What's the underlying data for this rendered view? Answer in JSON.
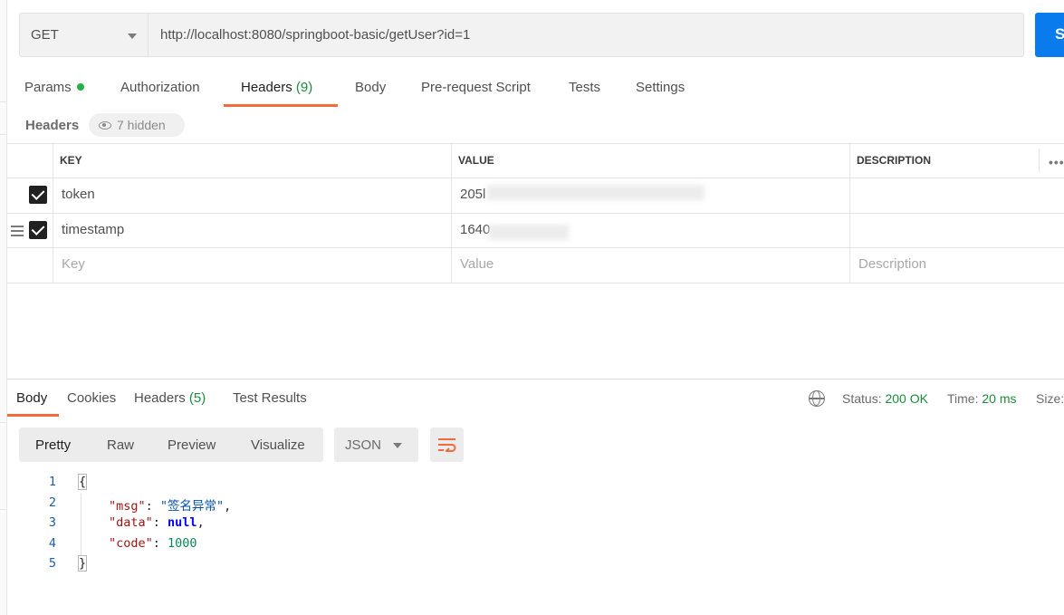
{
  "request": {
    "method": "GET",
    "url": "http://localhost:8080/springboot-basic/getUser?id=1",
    "send_label": "S"
  },
  "request_tabs": {
    "params": "Params",
    "authorization": "Authorization",
    "headers": "Headers",
    "headers_count": "(9)",
    "body": "Body",
    "prerequest": "Pre-request Script",
    "tests": "Tests",
    "settings": "Settings"
  },
  "headers_section": {
    "title": "Headers",
    "hidden_label": "7 hidden",
    "columns": {
      "key": "KEY",
      "value": "VALUE",
      "description": "DESCRIPTION"
    },
    "rows": [
      {
        "key": "token",
        "value": "205l",
        "checked": true
      },
      {
        "key": "timestamp",
        "value": "1640",
        "checked": true
      }
    ],
    "placeholders": {
      "key": "Key",
      "value": "Value",
      "description": "Description"
    }
  },
  "response_tabs": {
    "body": "Body",
    "cookies": "Cookies",
    "headers": "Headers",
    "headers_count": "(5)",
    "test_results": "Test Results"
  },
  "response_meta": {
    "status_label": "Status:",
    "status_value": "200 OK",
    "time_label": "Time:",
    "time_value": "20 ms",
    "size_label": "Size:"
  },
  "view_options": {
    "pretty": "Pretty",
    "raw": "Raw",
    "preview": "Preview",
    "visualize": "Visualize",
    "format": "JSON"
  },
  "response_body": {
    "line_numbers": [
      "1",
      "2",
      "3",
      "4",
      "5"
    ],
    "open_brace": "{",
    "close_brace": "}",
    "msg_key": "\"msg\"",
    "msg_value": "\"签名异常\"",
    "data_key": "\"data\"",
    "data_value": "null",
    "code_key": "\"code\"",
    "code_value": "1000",
    "colon": ": ",
    "comma": ","
  },
  "colors": {
    "accent": "#f26b3a",
    "send": "#097bed",
    "success": "#1d8a3c",
    "dot": "#26b047"
  }
}
